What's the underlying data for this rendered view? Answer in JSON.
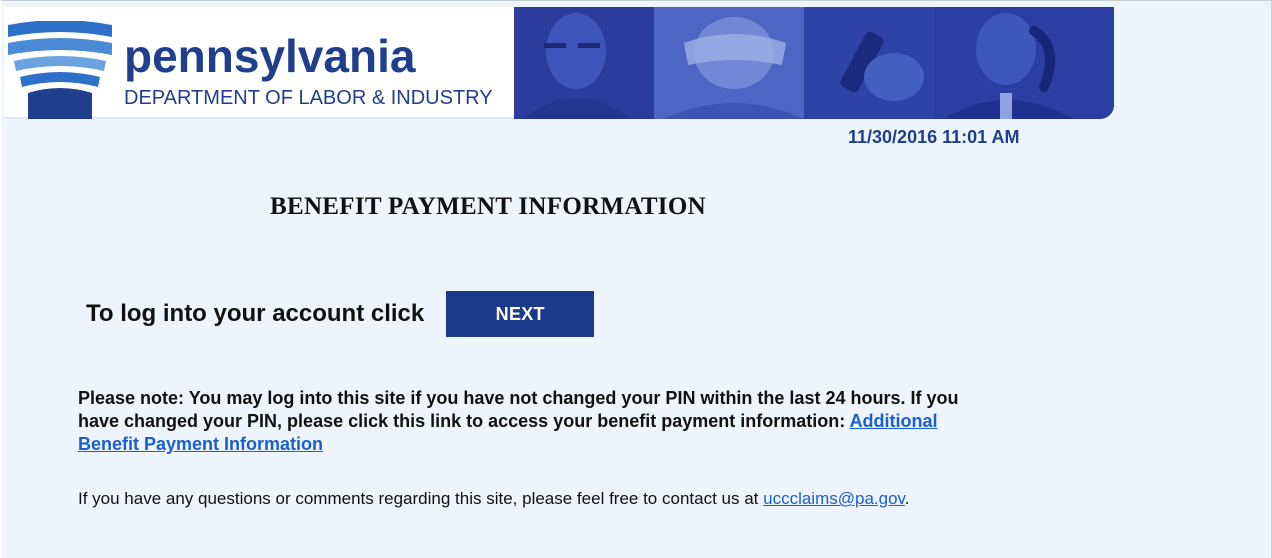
{
  "header": {
    "logo_title": "pennsylvania",
    "logo_subtitle": "DEPARTMENT OF LABOR & INDUSTRY",
    "colors": {
      "brand_blue": "#1f3f8c",
      "banner_blue": "#2d44a8"
    }
  },
  "timestamp": "11/30/2016 11:01 AM",
  "page_title": "BENEFIT PAYMENT INFORMATION",
  "login": {
    "prompt": "To log into your account click",
    "button_label": "NEXT"
  },
  "note": {
    "text": "Please note: You may log into this site if you have not changed your PIN within the last 24 hours. If you have changed your PIN, please click this link to access your benefit payment information: ",
    "link_label": "Additional Benefit Payment Information"
  },
  "contact": {
    "text_before": "If you have any questions or comments regarding this site, please feel free to contact us at ",
    "email": "uccclaims@pa.gov",
    "text_after": "."
  },
  "icons": {
    "logo": "keystone-logo-icon"
  }
}
